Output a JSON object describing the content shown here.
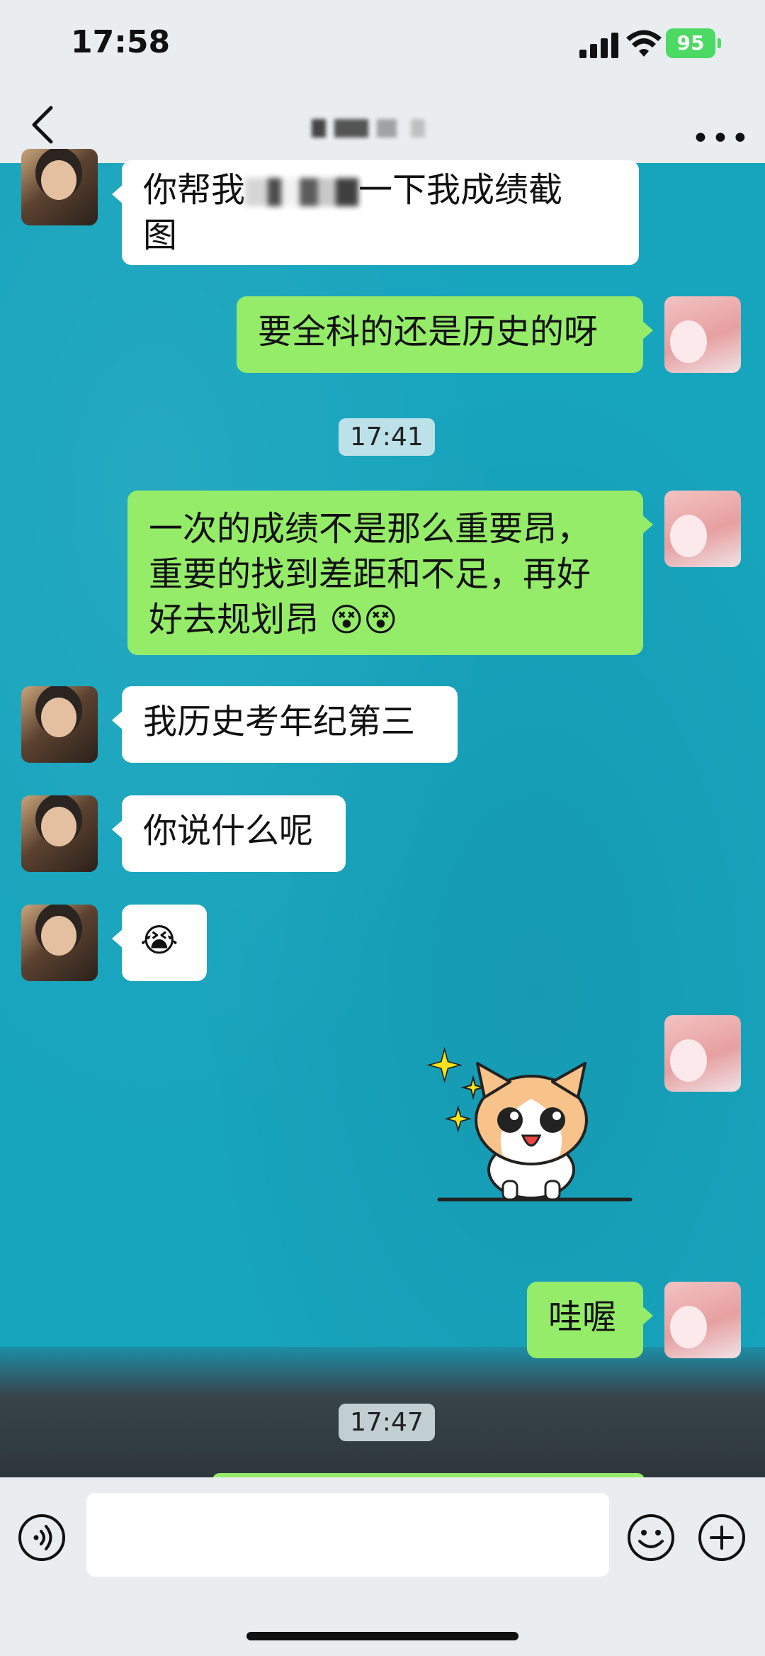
{
  "status_bar": {
    "time": "17:58",
    "battery": "95"
  },
  "header": {
    "title_redacted": true
  },
  "messages": [
    {
      "side": "left",
      "text_a": "你帮我",
      "text_b": "一下我成绩截",
      "text_c": "图"
    },
    {
      "side": "right",
      "text": "要全科的还是历史的呀"
    },
    {
      "type": "time",
      "text": "17:41"
    },
    {
      "side": "right",
      "text_line1": "一次的成绩不是那么重要昂，",
      "text_line2": "重要的找到差距和不足，再好",
      "text_line3": "好去规划昂"
    },
    {
      "side": "left",
      "text": "我历史考年纪第三"
    },
    {
      "side": "left",
      "text": "你说什么呢"
    },
    {
      "side": "left",
      "emoji": "😭"
    },
    {
      "side": "right",
      "sticker": "cat-sticker"
    },
    {
      "side": "right",
      "text": "哇喔"
    },
    {
      "type": "time",
      "text": "17:47"
    }
  ],
  "icons": {
    "back": "chevron-left-icon",
    "more": "more-icon",
    "voice": "voice-icon",
    "emoji": "emoji-icon",
    "plus": "plus-icon",
    "signal": "signal-icon",
    "wifi": "wifi-icon"
  },
  "colors": {
    "sent_bubble": "#95ec69",
    "received_bubble": "#ffffff",
    "header_bg": "#e9edf0",
    "wallpaper": "#17a4bd"
  }
}
